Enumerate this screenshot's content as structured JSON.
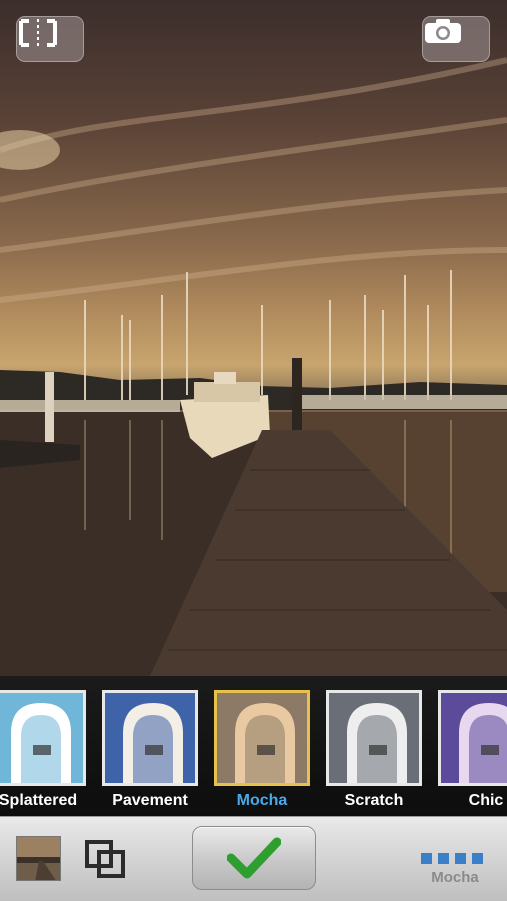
{
  "filters": [
    {
      "label": "Splattered",
      "selected": false,
      "tint": "#6fb6d8",
      "arch": "#ffffff"
    },
    {
      "label": "Pavement",
      "selected": false,
      "tint": "#3f63a8",
      "arch": "#f3efe6"
    },
    {
      "label": "Mocha",
      "selected": true,
      "tint": "#8c7a66",
      "arch": "#e9c9a1"
    },
    {
      "label": "Scratch",
      "selected": false,
      "tint": "#6a6f77",
      "arch": "#eeeeee"
    },
    {
      "label": "Chic",
      "selected": false,
      "tint": "#5b4b9a",
      "arch": "#e7d7ef"
    }
  ],
  "toolbar": {
    "current_filter": "Mocha"
  },
  "colors": {
    "selected_label": "#4aa8e8",
    "selected_border": "#e6c24a",
    "check": "#2e9e2e",
    "dots": "#3b7fc9"
  }
}
